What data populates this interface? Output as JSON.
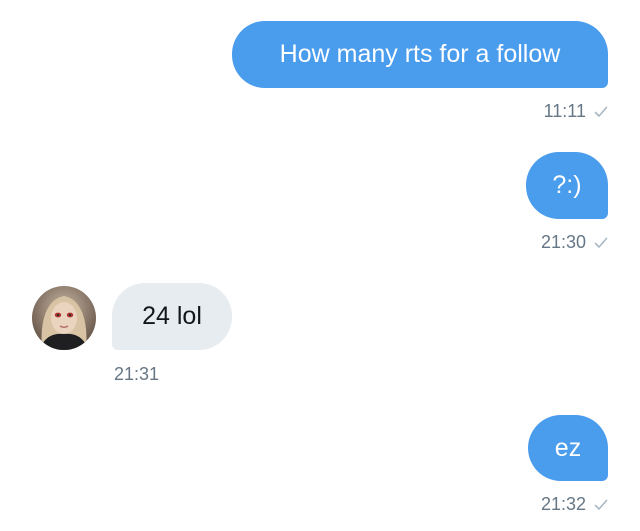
{
  "messages": [
    {
      "text": "How many rts for a follow",
      "time": "11:11",
      "direction": "sent"
    },
    {
      "text": "?:)",
      "time": "21:30",
      "direction": "sent"
    },
    {
      "text": "24 lol",
      "time": "21:31",
      "direction": "received"
    },
    {
      "text": "ez",
      "time": "21:32",
      "direction": "sent"
    }
  ],
  "icons": {
    "read_receipt": "checkmark-icon",
    "avatar": "user-avatar"
  },
  "colors": {
    "sent_bubble": "#4a9ced",
    "received_bubble": "#e6ecf0",
    "timestamp": "#657786",
    "checkmark": "#aab8c2"
  }
}
